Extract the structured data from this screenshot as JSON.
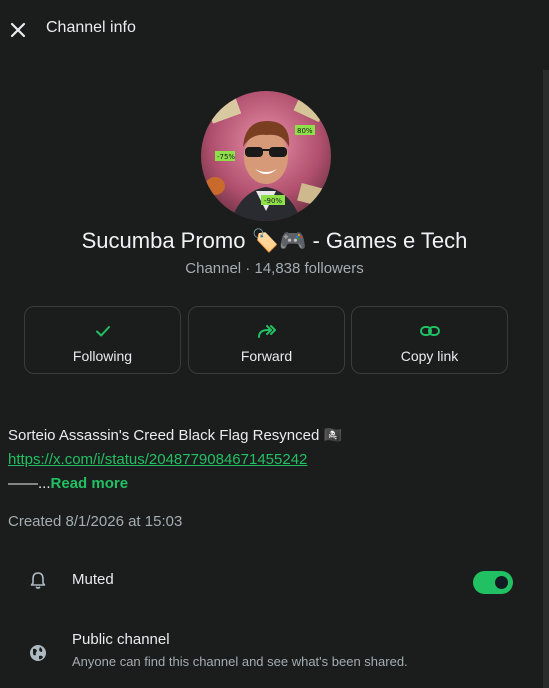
{
  "header": {
    "title": "Channel info"
  },
  "channel": {
    "name": "Sucumba Promo 🏷️🎮 - Games e Tech",
    "meta": "Channel · 14,838 followers",
    "avatar_badges": [
      "80%",
      "-75%",
      "-90%"
    ]
  },
  "actions": [
    {
      "label": "Following",
      "icon": "check-icon"
    },
    {
      "label": "Forward",
      "icon": "forward-icon"
    },
    {
      "label": "Copy link",
      "icon": "link-icon"
    }
  ],
  "description": {
    "line1": "Sorteio Assassin's Creed Black Flag Resynced 🏴‍☠️",
    "link": "https://x.com/i/status/2048779084671455242",
    "line3_prefix": "——...",
    "read_more": "Read more"
  },
  "created": "Created 8/1/2026 at 15:03",
  "muted": {
    "label": "Muted",
    "enabled": true
  },
  "public": {
    "title": "Public channel",
    "subtitle": "Anyone can find this channel and see what's been shared."
  },
  "colors": {
    "accent": "#21c063",
    "background": "#1b1c1c"
  }
}
